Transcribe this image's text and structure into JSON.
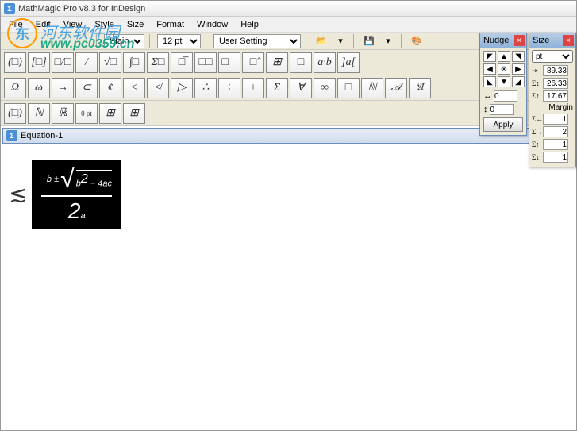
{
  "app": {
    "title": "MathMagic Pro v8.3 for InDesign",
    "icon_letter": "Σ"
  },
  "menu": [
    "File",
    "Edit",
    "View",
    "Style",
    "Size",
    "Format",
    "Window",
    "Help"
  ],
  "watermark": {
    "cn": "河东软件园",
    "url": "www.pc0359.cn"
  },
  "toolbar": {
    "font": "Plain",
    "size": "12 pt",
    "setting": "User Setting"
  },
  "template_rows": {
    "row1": [
      "(□)",
      "[□]",
      "□/□",
      "/",
      "√□",
      "∫□",
      "Σ□",
      "□̅",
      "□□",
      "□⃗",
      "□̂",
      "⊞",
      "□",
      "a·b",
      "]a["
    ],
    "row2": [
      "Ω",
      "ω",
      "→",
      "⊂",
      "¢",
      "≤",
      "≰",
      "▷",
      "∴",
      "÷",
      "±",
      "Σ",
      "∀",
      "∞",
      "□",
      "ℕ",
      "𝒜",
      "𝔄"
    ],
    "row3": [
      "(□)",
      "ℕ",
      "ℝ",
      "0 pt",
      "⊞",
      "⊞"
    ]
  },
  "document": {
    "title": "Equation-1",
    "icon_letter": "Σ"
  },
  "equation": {
    "prefix": "≲",
    "numerator": "−b ± √(b² − 4ac)",
    "denominator": "2a"
  },
  "nudge": {
    "title": "Nudge",
    "h_value": "0",
    "v_value": "0",
    "apply": "Apply"
  },
  "size": {
    "title": "Size",
    "unit": "pt",
    "v1": "89.33",
    "v2": "26.33",
    "v3": "17.67",
    "margin_label": "Margin",
    "m1": "1",
    "m2": "2",
    "m3": "1",
    "m4": "1"
  }
}
